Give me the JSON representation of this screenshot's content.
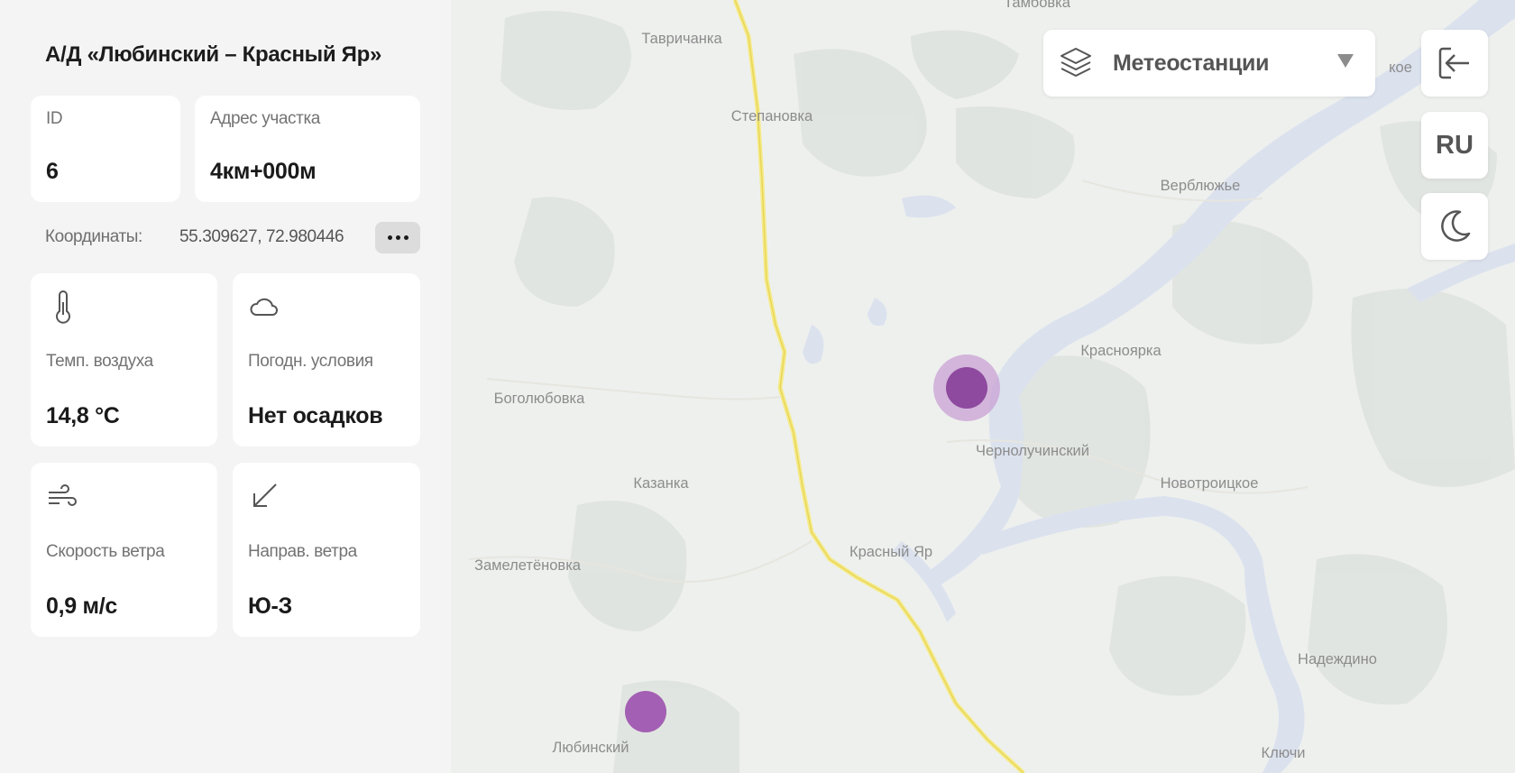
{
  "panel": {
    "title": "А/Д «Любинский – Красный Яр»",
    "id_label": "ID",
    "id_value": "6",
    "address_label": "Адрес участка",
    "address_value": "4км+000м",
    "coords_label": "Координаты:",
    "coords_value": "55.309627, 72.980446",
    "weather": [
      {
        "icon": "thermometer-icon",
        "label": "Темп. воздуха",
        "value": "14,8 °C"
      },
      {
        "icon": "cloud-icon",
        "label": "Погодн. условия",
        "value": "Нет осадков"
      },
      {
        "icon": "wind-icon",
        "label": "Скорость ветра",
        "value": "0,9 м/с"
      },
      {
        "icon": "arrow-down-left-icon",
        "label": "Направ. ветра",
        "value": "Ю-З"
      }
    ]
  },
  "layers": {
    "icon": "layers-icon",
    "label": "Метеостанции"
  },
  "controls": {
    "exit_icon": "exit-icon",
    "language": "RU",
    "theme_icon": "moon-icon"
  },
  "map": {
    "places": [
      "Тамбовка",
      "Тавричанка",
      "Степановка",
      "Верблюжье",
      "Красноярка",
      "Боголюбовка",
      "Чернолучинский",
      "Новотроицкое",
      "Казанка",
      "Красный Яр",
      "Замелетёновка",
      "Надеждино",
      "Любинский",
      "Ключи",
      "кое"
    ],
    "markers": [
      {
        "type": "weather-station",
        "state": "selected",
        "color": "#8e4a9e"
      },
      {
        "type": "weather-station",
        "state": "normal",
        "color": "#a35fb3"
      }
    ]
  }
}
